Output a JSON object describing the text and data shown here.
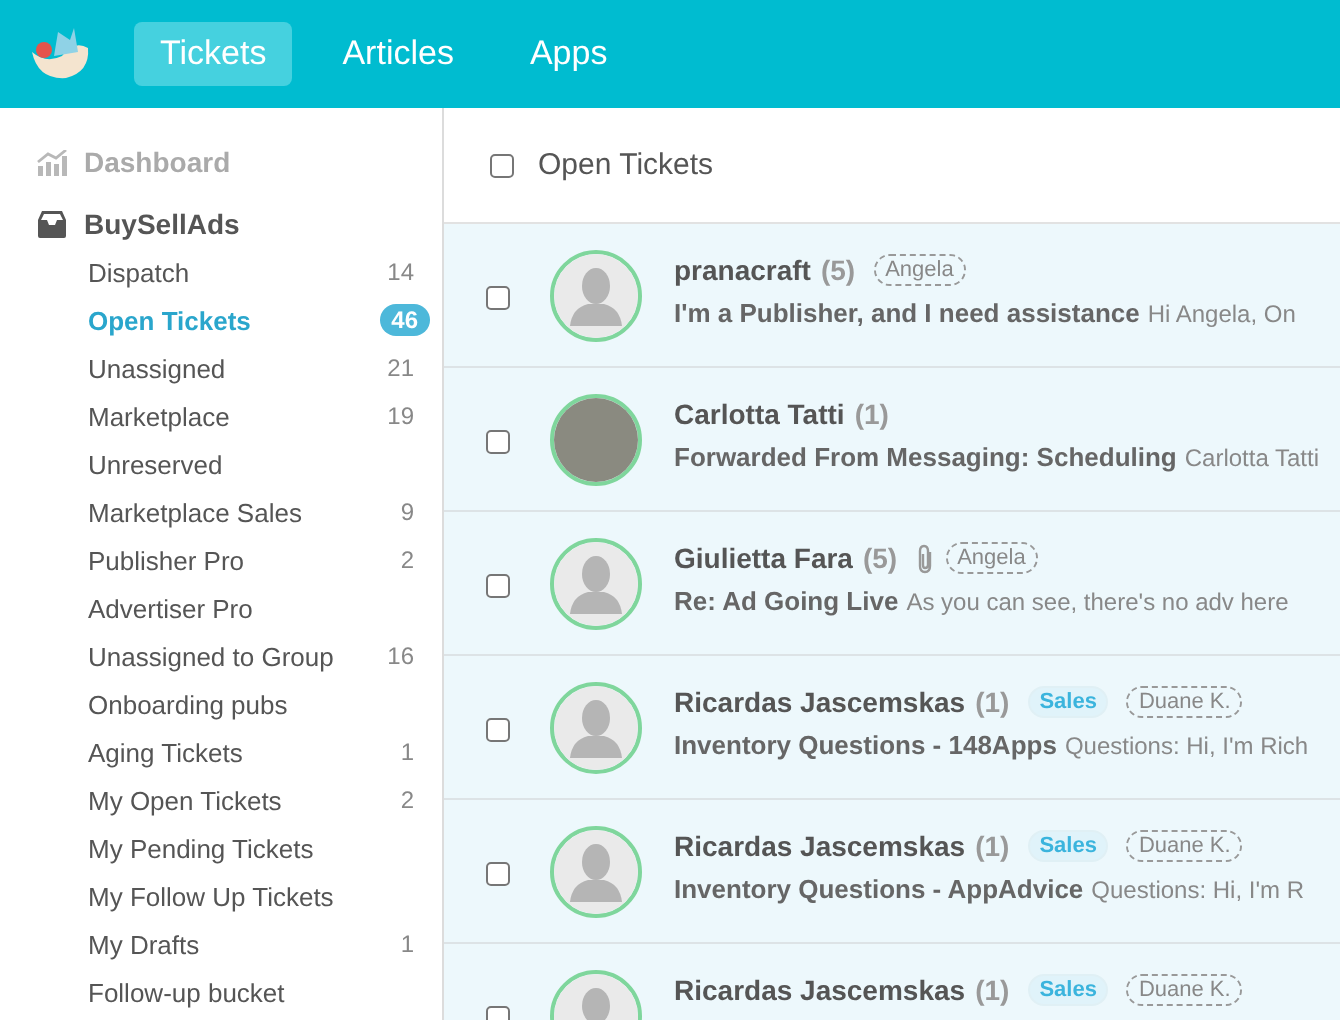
{
  "top_nav": {
    "tabs": [
      {
        "label": "Tickets",
        "selected": true
      },
      {
        "label": "Articles",
        "selected": false
      },
      {
        "label": "Apps",
        "selected": false
      }
    ]
  },
  "sidebar": {
    "dashboard": "Dashboard",
    "group": "BuySellAds",
    "items": [
      {
        "label": "Dispatch",
        "count": "14",
        "selected": false
      },
      {
        "label": "Open Tickets",
        "count": "46",
        "selected": true
      },
      {
        "label": "Unassigned",
        "count": "21",
        "selected": false
      },
      {
        "label": "Marketplace",
        "count": "19",
        "selected": false
      },
      {
        "label": "Unreserved",
        "selected": false
      },
      {
        "label": "Marketplace Sales",
        "count": "9",
        "selected": false
      },
      {
        "label": "Publisher Pro",
        "count": "2",
        "selected": false
      },
      {
        "label": "Advertiser Pro",
        "selected": false
      },
      {
        "label": "Unassigned to Group",
        "count": "16",
        "selected": false
      },
      {
        "label": "Onboarding pubs",
        "selected": false
      },
      {
        "label": "Aging Tickets",
        "count": "1",
        "selected": false
      },
      {
        "label": "My Open Tickets",
        "count": "2",
        "selected": false
      },
      {
        "label": "My Pending Tickets",
        "selected": false
      },
      {
        "label": "My Follow Up Tickets",
        "selected": false
      },
      {
        "label": "My Drafts",
        "count": "1",
        "selected": false
      },
      {
        "label": "Follow-up bucket",
        "selected": false
      }
    ]
  },
  "list": {
    "title": "Open Tickets",
    "checked": false,
    "tickets": [
      {
        "name": "pranacraft",
        "count": "(5)",
        "avatar": {
          "kind": "silhouette"
        },
        "attachment": false,
        "checked": false,
        "tags": [
          {
            "kind": "assignee",
            "label": "Angela"
          }
        ],
        "subject": "I'm a Publisher, and I need assistance",
        "preview": "Hi Angela, On"
      },
      {
        "name": "Carlotta Tatti",
        "count": "(1)",
        "avatar": {
          "kind": "photo"
        },
        "attachment": false,
        "checked": false,
        "subject": "Forwarded From Messaging: Scheduling",
        "preview": "Carlotta Tatti"
      },
      {
        "name": "Giulietta Fara",
        "count": "(5)",
        "avatar": {
          "kind": "silhouette"
        },
        "attachment": true,
        "checked": false,
        "tags": [
          {
            "kind": "assignee",
            "label": "Angela"
          }
        ],
        "subject": "Re: Ad Going Live",
        "preview": "As you can see, there's no adv here"
      },
      {
        "name": "Ricardas Jascemskas",
        "count": "(1)",
        "avatar": {
          "kind": "silhouette"
        },
        "attachment": false,
        "checked": false,
        "tags": [
          {
            "kind": "group",
            "label": "Sales"
          },
          {
            "kind": "assignee",
            "label": "Duane K."
          }
        ],
        "subject": "Inventory Questions - 148Apps",
        "preview": "Questions: Hi, I'm Rich"
      },
      {
        "name": "Ricardas Jascemskas",
        "count": "(1)",
        "avatar": {
          "kind": "silhouette"
        },
        "attachment": false,
        "checked": false,
        "tags": [
          {
            "kind": "group",
            "label": "Sales"
          },
          {
            "kind": "assignee",
            "label": "Duane K."
          }
        ],
        "subject": "Inventory Questions - AppAdvice",
        "preview": "Questions: Hi, I'm R"
      },
      {
        "name": "Ricardas Jascemskas",
        "count": "(1)",
        "avatar": {
          "kind": "silhouette"
        },
        "attachment": false,
        "checked": false,
        "tags": [
          {
            "kind": "group",
            "label": "Sales"
          },
          {
            "kind": "assignee",
            "label": "Duane K."
          }
        ]
      }
    ]
  }
}
